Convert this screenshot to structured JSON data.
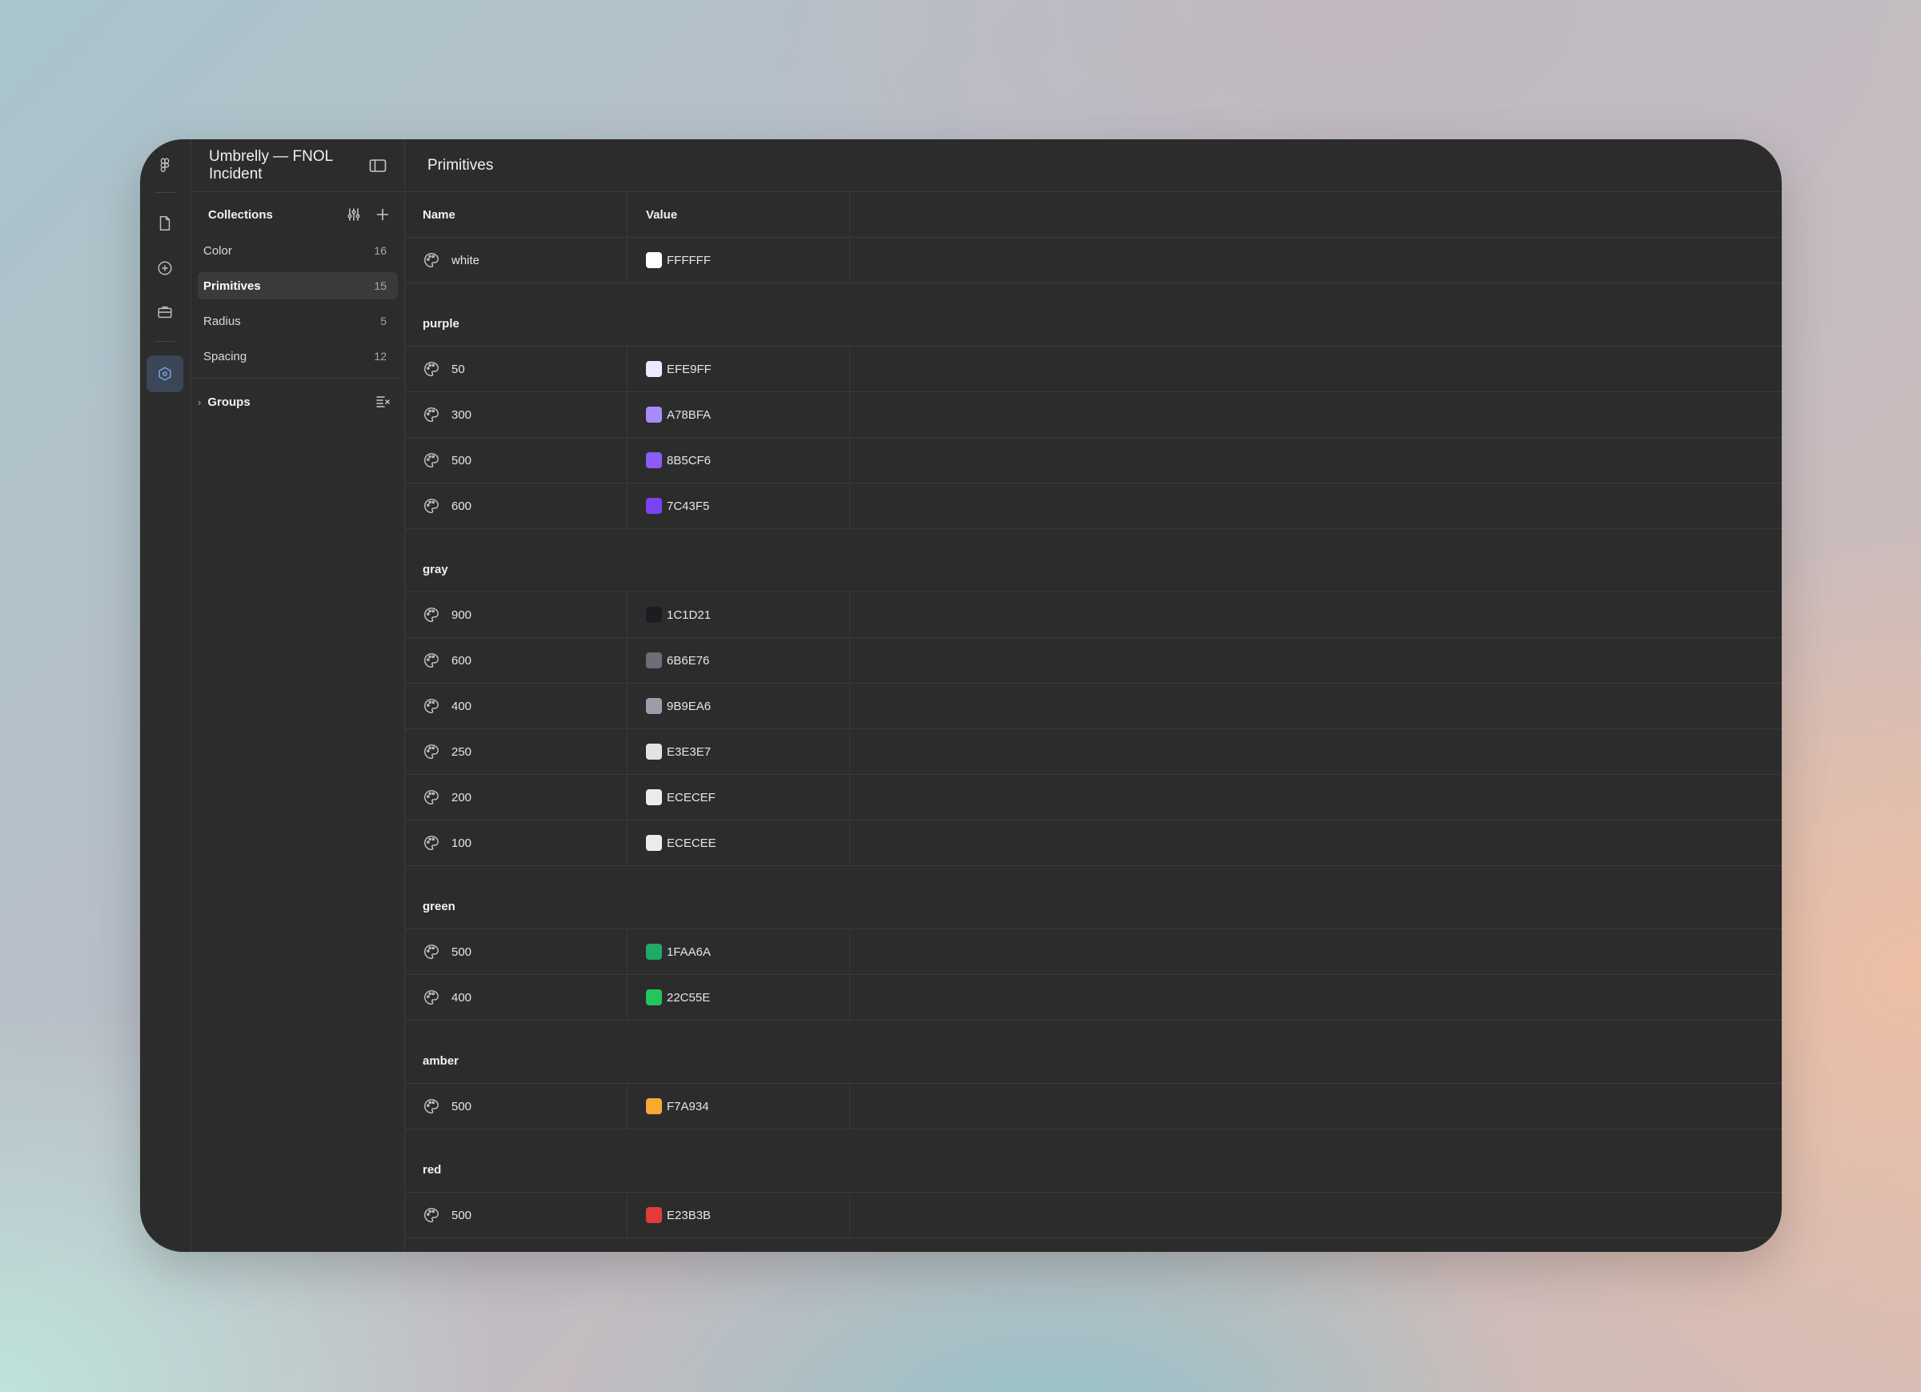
{
  "rail": {
    "items": [
      {
        "name": "figma-logo-icon"
      },
      {
        "name": "file-icon"
      },
      {
        "name": "add-circle-icon"
      },
      {
        "name": "toolbox-icon"
      },
      {
        "name": "variables-icon"
      }
    ]
  },
  "panel": {
    "title": "Umbrelly — FNOL Incident",
    "collections_label": "Collections",
    "collections": [
      {
        "label": "Color",
        "count": "16"
      },
      {
        "label": "Primitives",
        "count": "15"
      },
      {
        "label": "Radius",
        "count": "5"
      },
      {
        "label": "Spacing",
        "count": "12"
      }
    ],
    "groups_label": "Groups"
  },
  "main": {
    "title": "Primitives",
    "columns": {
      "name": "Name",
      "value": "Value"
    },
    "top_rows": [
      {
        "name": "white",
        "value": "FFFFFF",
        "color": "#FFFFFF"
      }
    ],
    "groups": [
      {
        "label": "purple",
        "rows": [
          {
            "name": "50",
            "value": "EFE9FF",
            "color": "#EFE9FF"
          },
          {
            "name": "300",
            "value": "A78BFA",
            "color": "#A78BFA"
          },
          {
            "name": "500",
            "value": "8B5CF6",
            "color": "#8B5CF6"
          },
          {
            "name": "600",
            "value": "7C43F5",
            "color": "#7C43F5"
          }
        ]
      },
      {
        "label": "gray",
        "rows": [
          {
            "name": "900",
            "value": "1C1D21",
            "color": "#1C1D21"
          },
          {
            "name": "600",
            "value": "6B6E76",
            "color": "#6B6E76"
          },
          {
            "name": "400",
            "value": "9B9EA6",
            "color": "#9B9EA6"
          },
          {
            "name": "250",
            "value": "E3E3E7",
            "color": "#E3E3E7"
          },
          {
            "name": "200",
            "value": "ECECEF",
            "color": "#ECECEF"
          },
          {
            "name": "100",
            "value": "ECECEE",
            "color": "#ECECEE"
          }
        ]
      },
      {
        "label": "green",
        "rows": [
          {
            "name": "500",
            "value": "1FAA6A",
            "color": "#1FAA6A"
          },
          {
            "name": "400",
            "value": "22C55E",
            "color": "#22C55E"
          }
        ]
      },
      {
        "label": "amber",
        "rows": [
          {
            "name": "500",
            "value": "F7A934",
            "color": "#F7A934"
          }
        ]
      },
      {
        "label": "red",
        "rows": [
          {
            "name": "500",
            "value": "E23B3B",
            "color": "#E23B3B"
          }
        ]
      }
    ]
  }
}
